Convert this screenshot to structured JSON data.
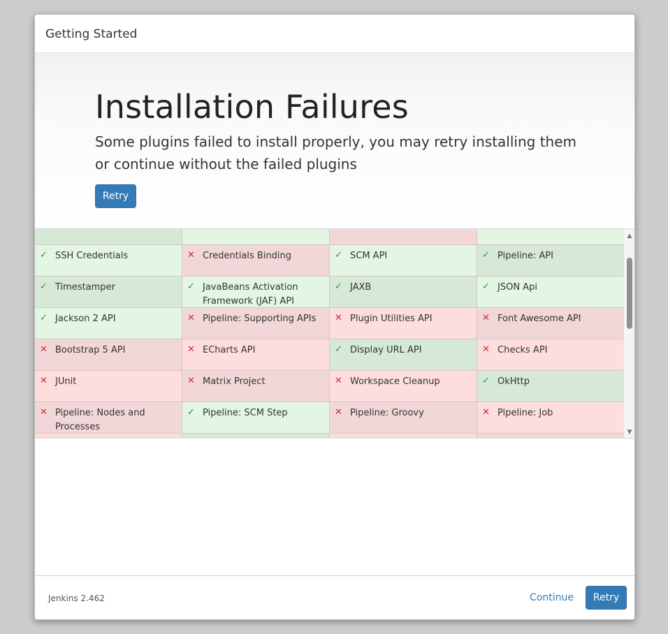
{
  "dialog": {
    "title": "Getting Started"
  },
  "hero": {
    "heading": "Installation Failures",
    "description": "Some plugins failed to install properly, you may retry installing them or continue without the failed plugins",
    "retry_label": "Retry"
  },
  "plugins": [
    {
      "name": "",
      "status": "ok"
    },
    {
      "name": "",
      "status": "ok"
    },
    {
      "name": "",
      "status": "fail"
    },
    {
      "name": "",
      "status": "ok"
    },
    {
      "name": "SSH Credentials",
      "status": "ok"
    },
    {
      "name": "Credentials Binding",
      "status": "fail"
    },
    {
      "name": "SCM API",
      "status": "ok"
    },
    {
      "name": "Pipeline: API",
      "status": "ok"
    },
    {
      "name": "Timestamper",
      "status": "ok"
    },
    {
      "name": "JavaBeans Activation Framework (JAF) API",
      "status": "ok"
    },
    {
      "name": "JAXB",
      "status": "ok"
    },
    {
      "name": "JSON Api",
      "status": "ok"
    },
    {
      "name": "Jackson 2 API",
      "status": "ok"
    },
    {
      "name": "Pipeline: Supporting APIs",
      "status": "fail"
    },
    {
      "name": "Plugin Utilities API",
      "status": "fail"
    },
    {
      "name": "Font Awesome API",
      "status": "fail"
    },
    {
      "name": "Bootstrap 5 API",
      "status": "fail"
    },
    {
      "name": "ECharts API",
      "status": "fail"
    },
    {
      "name": "Display URL API",
      "status": "ok"
    },
    {
      "name": "Checks API",
      "status": "fail"
    },
    {
      "name": "JUnit",
      "status": "fail"
    },
    {
      "name": "Matrix Project",
      "status": "fail"
    },
    {
      "name": "Workspace Cleanup",
      "status": "fail"
    },
    {
      "name": "OkHttp",
      "status": "ok"
    },
    {
      "name": "Pipeline: Nodes and Processes",
      "status": "fail"
    },
    {
      "name": "Pipeline: SCM Step",
      "status": "ok"
    },
    {
      "name": "Pipeline: Groovy",
      "status": "fail"
    },
    {
      "name": "Pipeline: Job",
      "status": "fail"
    },
    {
      "name": "",
      "status": "fail"
    },
    {
      "name": "",
      "status": "ok"
    },
    {
      "name": "",
      "status": "fail"
    },
    {
      "name": "",
      "status": "fail"
    }
  ],
  "icons": {
    "ok": "check-icon",
    "fail": "cross-icon",
    "ok_glyph": "✓",
    "fail_glyph": "✕"
  },
  "colors": {
    "ok_a": "#d6e9d6",
    "ok_b": "#e3f6e3",
    "fail_a": "#f2d7d8",
    "fail_b": "#fdddde",
    "primary": "#337ab7"
  },
  "footer": {
    "version": "Jenkins 2.462",
    "continue_label": "Continue",
    "retry_label": "Retry"
  }
}
